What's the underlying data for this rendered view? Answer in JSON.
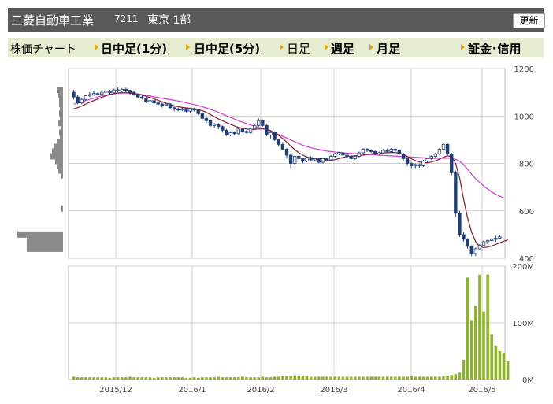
{
  "header": {
    "company": "三菱自動車工業",
    "code": "7211",
    "market": "東京 1部",
    "refresh_label": "更新"
  },
  "nav": {
    "chart_label": "株価チャート",
    "items": [
      {
        "label": "日中足(1分)",
        "active": true
      },
      {
        "label": "日中足(5分)",
        "active": true
      },
      {
        "label": "日足",
        "active": false
      },
      {
        "label": "週足",
        "active": true
      },
      {
        "label": "月足",
        "active": true
      },
      {
        "label": "証金･信用",
        "active": true
      }
    ]
  },
  "colors": {
    "up_candle": "#ffffff",
    "down_candle": "#1f3f7a",
    "moving_average_25": "#8b1a2a",
    "moving_average_75": "#d43ad4",
    "volume": "#8db32b",
    "volume_profile": "#8a8a8a"
  },
  "chart_data": [
    {
      "type": "candlestick",
      "title": "",
      "x_ticks": [
        "2015/12",
        "2016/1",
        "2016/2",
        "2016/3",
        "2016/4",
        "2016/5"
      ],
      "ylim": [
        400,
        1200
      ],
      "y_ticks": [
        400,
        600,
        800,
        1000,
        1200
      ],
      "grid": true,
      "series": [
        {
          "type": "candlestick",
          "values": [
            [
              1100,
              1080,
              1110,
              1070
            ],
            [
              1080,
              1055,
              1090,
              1050
            ],
            [
              1055,
              1070,
              1075,
              1050
            ],
            [
              1070,
              1085,
              1090,
              1065
            ],
            [
              1085,
              1090,
              1100,
              1080
            ],
            [
              1090,
              1095,
              1105,
              1085
            ],
            [
              1095,
              1092,
              1100,
              1085
            ],
            [
              1092,
              1100,
              1108,
              1088
            ],
            [
              1100,
              1105,
              1110,
              1095
            ],
            [
              1105,
              1098,
              1110,
              1090
            ],
            [
              1098,
              1110,
              1115,
              1095
            ],
            [
              1110,
              1105,
              1120,
              1100
            ],
            [
              1105,
              1112,
              1118,
              1100
            ],
            [
              1112,
              1108,
              1120,
              1100
            ],
            [
              1108,
              1100,
              1110,
              1090
            ],
            [
              1100,
              1090,
              1105,
              1085
            ],
            [
              1090,
              1080,
              1095,
              1075
            ],
            [
              1080,
              1075,
              1090,
              1070
            ],
            [
              1075,
              1060,
              1080,
              1055
            ],
            [
              1060,
              1065,
              1072,
              1055
            ],
            [
              1065,
              1055,
              1070,
              1050
            ],
            [
              1055,
              1050,
              1060,
              1040
            ],
            [
              1050,
              1045,
              1058,
              1035
            ],
            [
              1045,
              1050,
              1055,
              1040
            ],
            [
              1050,
              1035,
              1055,
              1030
            ],
            [
              1035,
              1030,
              1040,
              1020
            ],
            [
              1030,
              1025,
              1035,
              1020
            ],
            [
              1025,
              1030,
              1038,
              1020
            ],
            [
              1030,
              1020,
              1035,
              1015
            ],
            [
              1020,
              1030,
              1035,
              1015
            ],
            [
              1030,
              1025,
              1035,
              1018
            ],
            [
              1025,
              1010,
              1030,
              1005
            ],
            [
              1010,
              990,
              1015,
              985
            ],
            [
              990,
              980,
              995,
              970
            ],
            [
              980,
              960,
              985,
              955
            ],
            [
              960,
              965,
              970,
              950
            ],
            [
              965,
              955,
              970,
              945
            ],
            [
              955,
              940,
              960,
              930
            ],
            [
              940,
              920,
              945,
              915
            ],
            [
              920,
              930,
              935,
              915
            ],
            [
              930,
              925,
              935,
              918
            ],
            [
              925,
              945,
              950,
              920
            ],
            [
              945,
              935,
              950,
              930
            ],
            [
              935,
              930,
              940,
              925
            ],
            [
              930,
              945,
              950,
              925
            ],
            [
              945,
              960,
              965,
              940
            ],
            [
              960,
              980,
              990,
              955
            ],
            [
              980,
              960,
              985,
              955
            ],
            [
              960,
              920,
              965,
              915
            ],
            [
              920,
              930,
              935,
              905
            ],
            [
              930,
              900,
              935,
              895
            ],
            [
              900,
              880,
              905,
              870
            ],
            [
              880,
              860,
              890,
              855
            ],
            [
              860,
              835,
              865,
              820
            ],
            [
              835,
              800,
              840,
              780
            ],
            [
              800,
              830,
              835,
              795
            ],
            [
              830,
              820,
              835,
              810
            ],
            [
              820,
              810,
              825,
              800
            ],
            [
              810,
              825,
              830,
              805
            ],
            [
              825,
              815,
              830,
              810
            ],
            [
              815,
              820,
              825,
              810
            ],
            [
              820,
              805,
              825,
              800
            ],
            [
              805,
              820,
              825,
              800
            ],
            [
              820,
              815,
              825,
              808
            ],
            [
              815,
              830,
              835,
              812
            ],
            [
              830,
              840,
              845,
              825
            ],
            [
              840,
              845,
              850,
              835
            ],
            [
              845,
              835,
              850,
              830
            ],
            [
              835,
              830,
              840,
              825
            ],
            [
              830,
              820,
              835,
              815
            ],
            [
              820,
              830,
              835,
              815
            ],
            [
              830,
              845,
              850,
              825
            ],
            [
              845,
              860,
              865,
              840
            ],
            [
              860,
              855,
              865,
              848
            ],
            [
              855,
              850,
              860,
              845
            ],
            [
              850,
              840,
              855,
              835
            ],
            [
              840,
              845,
              850,
              835
            ],
            [
              845,
              855,
              860,
              840
            ],
            [
              855,
              850,
              862,
              845
            ],
            [
              850,
              860,
              865,
              845
            ],
            [
              860,
              855,
              865,
              848
            ],
            [
              855,
              840,
              860,
              835
            ],
            [
              840,
              820,
              845,
              810
            ],
            [
              820,
              800,
              825,
              790
            ],
            [
              800,
              790,
              805,
              780
            ],
            [
              790,
              795,
              800,
              780
            ],
            [
              795,
              790,
              800,
              782
            ],
            [
              790,
              810,
              815,
              785
            ],
            [
              810,
              820,
              825,
              805
            ],
            [
              820,
              830,
              835,
              815
            ],
            [
              830,
              840,
              845,
              825
            ],
            [
              840,
              860,
              865,
              835
            ],
            [
              860,
              880,
              885,
              855
            ],
            [
              880,
              840,
              885,
              835
            ],
            [
              840,
              760,
              845,
              750
            ],
            [
              760,
              590,
              770,
              575
            ],
            [
              590,
              500,
              600,
              490
            ],
            [
              500,
              480,
              510,
              470
            ],
            [
              480,
              450,
              485,
              440
            ],
            [
              450,
              420,
              455,
              410
            ],
            [
              420,
              440,
              445,
              410
            ],
            [
              440,
              455,
              460,
              435
            ],
            [
              455,
              470,
              475,
              450
            ],
            [
              470,
              475,
              480,
              460
            ],
            [
              475,
              480,
              485,
              470
            ],
            [
              480,
              485,
              495,
              470
            ],
            [
              485,
              490,
              498,
              480
            ]
          ]
        },
        {
          "type": "line",
          "values": [
            1030,
            1035,
            1042,
            1050,
            1058,
            1065,
            1072,
            1079,
            1085,
            1090,
            1094,
            1097,
            1098,
            1098,
            1097,
            1095,
            1092,
            1088,
            1083,
            1078,
            1072,
            1066,
            1060,
            1054,
            1048,
            1043,
            1039,
            1036,
            1034,
            1032,
            1030,
            1027,
            1022,
            1015,
            1006,
            997,
            988,
            980,
            972,
            965,
            958,
            952,
            948,
            945,
            944,
            944,
            945,
            946,
            944,
            938,
            929,
            918,
            905,
            890,
            873,
            858,
            845,
            835,
            828,
            822,
            818,
            815,
            813,
            812,
            813,
            816,
            820,
            825,
            829,
            831,
            832,
            833,
            835,
            838,
            840,
            842,
            843,
            844,
            845,
            846,
            846,
            844,
            838,
            830,
            820,
            812,
            806,
            803,
            803,
            806,
            811,
            818,
            826,
            832,
            830,
            800,
            740,
            650,
            570,
            510,
            470,
            450,
            445,
            447,
            452,
            458,
            465,
            472,
            478
          ]
        },
        {
          "type": "line",
          "values": [
            1050,
            1055,
            1060,
            1065,
            1070,
            1075,
            1080,
            1085,
            1088,
            1091,
            1094,
            1096,
            1097,
            1097,
            1096,
            1094,
            1092,
            1090,
            1087,
            1084,
            1081,
            1078,
            1075,
            1072,
            1069,
            1066,
            1063,
            1060,
            1056,
            1052,
            1048,
            1044,
            1039,
            1034,
            1028,
            1022,
            1015,
            1008,
            1001,
            994,
            987,
            980,
            974,
            968,
            962,
            957,
            952,
            947,
            942,
            936,
            929,
            922,
            915,
            907,
            899,
            891,
            884,
            877,
            871,
            866,
            862,
            858,
            855,
            852,
            850,
            848,
            846,
            845,
            843,
            842,
            841,
            840,
            839,
            838,
            837,
            836,
            835,
            834,
            833,
            832,
            831,
            830,
            829,
            828,
            827,
            826,
            825,
            824,
            823,
            822,
            822,
            822,
            822,
            822,
            821,
            818,
            810,
            795,
            775,
            755,
            735,
            720,
            705,
            692,
            680,
            670,
            662,
            655
          ]
        }
      ]
    },
    {
      "type": "bar",
      "title": "",
      "ylim": [
        0,
        200
      ],
      "y_ticks": [
        "0M",
        "100M",
        "200M"
      ],
      "grid": true,
      "series": [
        {
          "name": "",
          "values": [
            5,
            4,
            4,
            4,
            4,
            4,
            4,
            4,
            4,
            3,
            4,
            4,
            4,
            4,
            5,
            4,
            4,
            4,
            4,
            4,
            3,
            4,
            4,
            4,
            4,
            4,
            4,
            4,
            3,
            3,
            4,
            3,
            4,
            4,
            4,
            4,
            5,
            4,
            4,
            4,
            4,
            4,
            5,
            4,
            4,
            4,
            4,
            5,
            4,
            4,
            5,
            5,
            6,
            6,
            6,
            7,
            7,
            6,
            6,
            5,
            5,
            5,
            5,
            5,
            5,
            5,
            5,
            5,
            5,
            5,
            5,
            5,
            5,
            5,
            5,
            5,
            5,
            5,
            5,
            5,
            5,
            5,
            5,
            5,
            6,
            5,
            5,
            5,
            5,
            5,
            5,
            5,
            6,
            7,
            8,
            10,
            12,
            35,
            180,
            105,
            130,
            185,
            120,
            185,
            80,
            60,
            50,
            47,
            32
          ]
        }
      ]
    }
  ]
}
